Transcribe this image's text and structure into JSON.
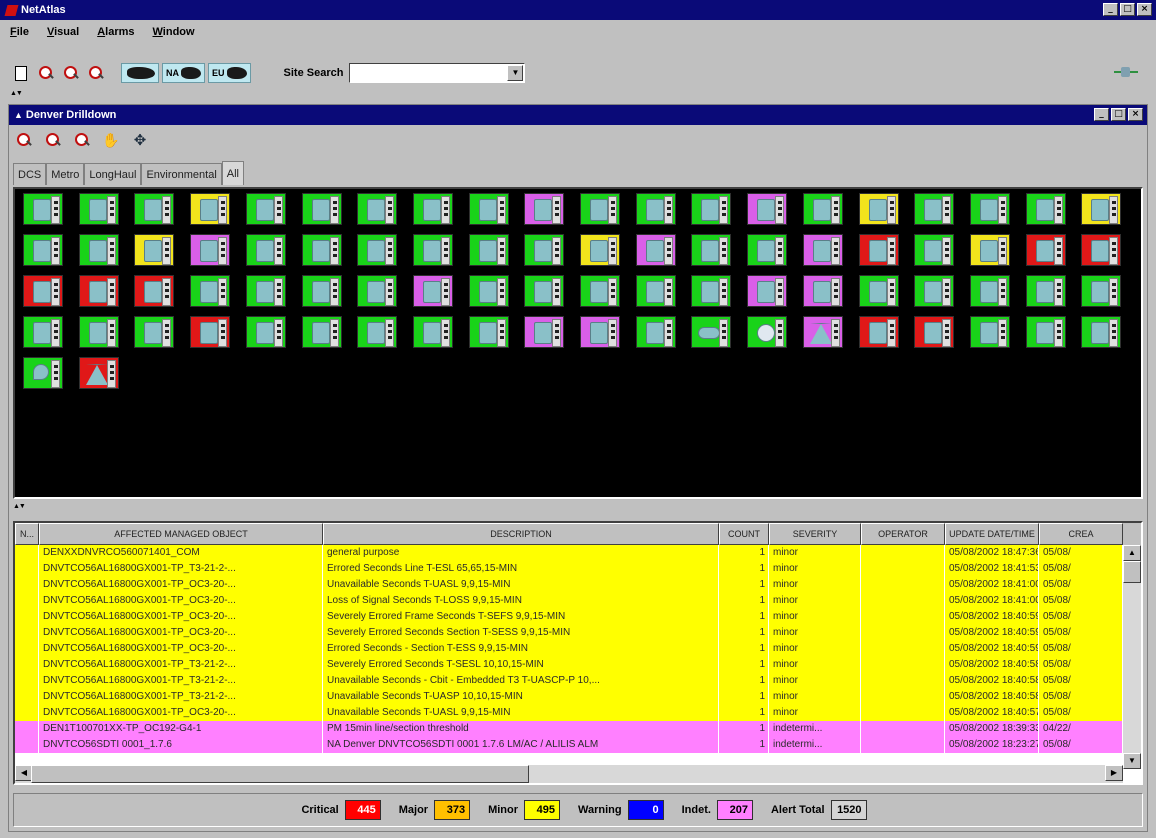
{
  "app": {
    "title": "NetAtlas"
  },
  "menu": [
    "File",
    "Visual",
    "Alarms",
    "Window"
  ],
  "toolbar": {
    "map_buttons": [
      {
        "label": "",
        "icon": "world-map-icon"
      },
      {
        "label": "NA",
        "icon": "north-america-map-icon"
      },
      {
        "label": "EU",
        "icon": "europe-map-icon"
      }
    ],
    "site_search_label": "Site Search",
    "site_search_value": ""
  },
  "drilldown": {
    "title": "Denver Drilldown",
    "tabs": [
      "DCS",
      "Metro",
      "LongHaul",
      "Environmental",
      "All"
    ],
    "active_tab": "All",
    "node_colors": {
      "green": "#19d319",
      "yellow": "#f2e41c",
      "magenta": "#d95fe8",
      "red": "#e01818"
    },
    "node_rows": [
      [
        "green",
        "green",
        "green",
        "yellow",
        "green",
        "green",
        "green",
        "green",
        "green",
        "magenta",
        "green",
        "green",
        "green",
        "magenta",
        "green",
        "yellow",
        "green",
        "green",
        "green",
        "yellow"
      ],
      [
        "green",
        "green",
        "yellow",
        "magenta",
        "green",
        "green",
        "green",
        "green",
        "green",
        "green",
        "yellow",
        "magenta",
        "green",
        "green",
        "magenta",
        "red",
        "green",
        "yellow",
        "red",
        "red"
      ],
      [
        "red",
        "red",
        "red",
        "green",
        "green",
        "green",
        "green",
        "magenta",
        "green",
        "green",
        "green",
        "green",
        "green",
        "magenta",
        "magenta",
        "green",
        "green",
        "green",
        "green",
        "green"
      ],
      [
        "green",
        "green",
        "green",
        "red",
        "green",
        "green",
        "green",
        "green",
        "green",
        "magenta",
        "magenta",
        "green",
        "green",
        "green",
        "magenta",
        "red",
        "red",
        "green",
        "green",
        "green"
      ],
      [
        "green",
        "red"
      ]
    ],
    "special_nodes": {
      "3": {
        "12": "cloud",
        "13": "fan",
        "14": "triangle"
      },
      "4": {
        "0": "pin",
        "1": "triangle"
      }
    }
  },
  "alarms": {
    "columns": [
      "N...",
      "AFFECTED MANAGED OBJECT",
      "DESCRIPTION",
      "COUNT",
      "SEVERITY",
      "OPERATOR",
      "UPDATE DATE/TIME",
      "CREA"
    ],
    "row_colors": {
      "minor": "#ffff00",
      "indeterminate": "#ff80ff"
    },
    "rows": [
      {
        "object": "DENXXDNVRCO560071401_COM",
        "description": "general purpose",
        "count": "1",
        "severity": "minor",
        "operator": "",
        "updated": "05/08/2002 18:47:36",
        "created": "05/08/",
        "type": "minor"
      },
      {
        "object": "DNVTCO56AL16800GX001-TP_T3-21-2-...",
        "description": "Errored Seconds Line T-ESL 65,65,15-MIN",
        "count": "1",
        "severity": "minor",
        "operator": "",
        "updated": "05/08/2002 18:41:53",
        "created": "05/08/",
        "type": "minor"
      },
      {
        "object": "DNVTCO56AL16800GX001-TP_OC3-20-...",
        "description": "Unavailable Seconds T-UASL 9,9,15-MIN",
        "count": "1",
        "severity": "minor",
        "operator": "",
        "updated": "05/08/2002 18:41:00",
        "created": "05/08/",
        "type": "minor"
      },
      {
        "object": "DNVTCO56AL16800GX001-TP_OC3-20-...",
        "description": "Loss of Signal Seconds T-LOSS 9,9,15-MIN",
        "count": "1",
        "severity": "minor",
        "operator": "",
        "updated": "05/08/2002 18:41:00",
        "created": "05/08/",
        "type": "minor"
      },
      {
        "object": "DNVTCO56AL16800GX001-TP_OC3-20-...",
        "description": "Severely Errored Frame Seconds T-SEFS 9,9,15-MIN",
        "count": "1",
        "severity": "minor",
        "operator": "",
        "updated": "05/08/2002 18:40:59",
        "created": "05/08/",
        "type": "minor"
      },
      {
        "object": "DNVTCO56AL16800GX001-TP_OC3-20-...",
        "description": "Severely Errored Seconds Section T-SESS 9,9,15-MIN",
        "count": "1",
        "severity": "minor",
        "operator": "",
        "updated": "05/08/2002 18:40:59",
        "created": "05/08/",
        "type": "minor"
      },
      {
        "object": "DNVTCO56AL16800GX001-TP_OC3-20-...",
        "description": "Errored Seconds - Section T-ESS 9,9,15-MIN",
        "count": "1",
        "severity": "minor",
        "operator": "",
        "updated": "05/08/2002 18:40:59",
        "created": "05/08/",
        "type": "minor"
      },
      {
        "object": "DNVTCO56AL16800GX001-TP_T3-21-2-...",
        "description": "Severely Errored Seconds T-SESL 10,10,15-MIN",
        "count": "1",
        "severity": "minor",
        "operator": "",
        "updated": "05/08/2002 18:40:58",
        "created": "05/08/",
        "type": "minor"
      },
      {
        "object": "DNVTCO56AL16800GX001-TP_T3-21-2-...",
        "description": "Unavailable Seconds - Cbit - Embedded T3 T-UASCP-P 10,...",
        "count": "1",
        "severity": "minor",
        "operator": "",
        "updated": "05/08/2002 18:40:58",
        "created": "05/08/",
        "type": "minor"
      },
      {
        "object": "DNVTCO56AL16800GX001-TP_T3-21-2-...",
        "description": "Unavailable Seconds T-UASP 10,10,15-MIN",
        "count": "1",
        "severity": "minor",
        "operator": "",
        "updated": "05/08/2002 18:40:58",
        "created": "05/08/",
        "type": "minor"
      },
      {
        "object": "DNVTCO56AL16800GX001-TP_OC3-20-...",
        "description": "Unavailable Seconds T-UASL 9,9,15-MIN",
        "count": "1",
        "severity": "minor",
        "operator": "",
        "updated": "05/08/2002 18:40:57",
        "created": "05/08/",
        "type": "minor"
      },
      {
        "object": "DEN1T100701XX-TP_OC192-G4-1",
        "description": "PM 15min line/section threshold",
        "count": "1",
        "severity": "indetermi...",
        "operator": "",
        "updated": "05/08/2002 18:39:33",
        "created": "04/22/",
        "type": "indeterminate"
      },
      {
        "object": "DNVTCO56SDTI 0001_1.7.6",
        "description": "NA Denver DNVTCO56SDTI 0001 1.7.6 LM/AC / ALILIS ALM",
        "count": "1",
        "severity": "indetermi...",
        "operator": "",
        "updated": "05/08/2002 18:23:27",
        "created": "05/08/",
        "type": "indeterminate"
      }
    ]
  },
  "status": [
    {
      "label": "Critical",
      "value": "445",
      "color": "#ff0000",
      "text_color": "#ffffff"
    },
    {
      "label": "Major",
      "value": "373",
      "color": "#ffc000",
      "text_color": "#000000"
    },
    {
      "label": "Minor",
      "value": "495",
      "color": "#ffff00",
      "text_color": "#000000"
    },
    {
      "label": "Warning",
      "value": "0",
      "color": "#0000ff",
      "text_color": "#ffffff"
    },
    {
      "label": "Indet.",
      "value": "207",
      "color": "#ff80ff",
      "text_color": "#000000"
    },
    {
      "label": "Alert Total",
      "value": "1520",
      "color": "#d4d4d4",
      "text_color": "#000000"
    }
  ]
}
